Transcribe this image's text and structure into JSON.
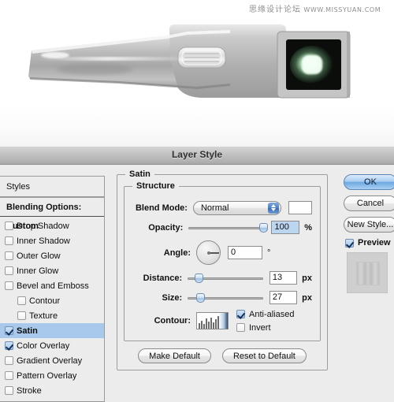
{
  "photo": {
    "watermark_cn": "思缘设计论坛",
    "watermark_url": "WWW.MISSYUAN.COM",
    "alt": "brushed-metal device with dark glowing screen"
  },
  "dialog": {
    "title": "Layer Style"
  },
  "sidebar": {
    "styles_label": "Styles",
    "blending_label": "Blending Options: Custom",
    "effects": [
      {
        "label": "Drop Shadow",
        "checked": false,
        "indent": false,
        "selected": false
      },
      {
        "label": "Inner Shadow",
        "checked": false,
        "indent": false,
        "selected": false
      },
      {
        "label": "Outer Glow",
        "checked": false,
        "indent": false,
        "selected": false
      },
      {
        "label": "Inner Glow",
        "checked": false,
        "indent": false,
        "selected": false
      },
      {
        "label": "Bevel and Emboss",
        "checked": false,
        "indent": false,
        "selected": false
      },
      {
        "label": "Contour",
        "checked": false,
        "indent": true,
        "selected": false
      },
      {
        "label": "Texture",
        "checked": false,
        "indent": true,
        "selected": false
      },
      {
        "label": "Satin",
        "checked": true,
        "indent": false,
        "selected": true
      },
      {
        "label": "Color Overlay",
        "checked": true,
        "indent": false,
        "selected": false
      },
      {
        "label": "Gradient Overlay",
        "checked": false,
        "indent": false,
        "selected": false
      },
      {
        "label": "Pattern Overlay",
        "checked": false,
        "indent": false,
        "selected": false
      },
      {
        "label": "Stroke",
        "checked": false,
        "indent": false,
        "selected": false
      }
    ]
  },
  "panel": {
    "group_title": "Satin",
    "structure_title": "Structure",
    "blend_mode": {
      "label": "Blend Mode:",
      "value": "Normal",
      "color_swatch": "#ffffff"
    },
    "opacity": {
      "label": "Opacity:",
      "value": "100",
      "unit": "%",
      "slider_percent": 92
    },
    "angle": {
      "label": "Angle:",
      "value": "0",
      "unit": "°",
      "degrees": 0
    },
    "distance": {
      "label": "Distance:",
      "value": "13",
      "unit": "px",
      "slider_percent": 9
    },
    "size": {
      "label": "Size:",
      "value": "27",
      "unit": "px",
      "slider_percent": 11
    },
    "contour": {
      "label": "Contour:",
      "anti_aliased_label": "Anti-aliased",
      "anti_aliased_checked": true,
      "invert_label": "Invert",
      "invert_checked": false
    },
    "make_default_label": "Make Default",
    "reset_default_label": "Reset to Default"
  },
  "actions": {
    "ok_label": "OK",
    "cancel_label": "Cancel",
    "new_style_label": "New Style...",
    "preview_label": "Preview",
    "preview_checked": true
  },
  "colors": {
    "selection_blue": "#a9c9ec",
    "default_button_blue": "#6ea8e2",
    "titlebar_gray": "#b4b4b4"
  }
}
